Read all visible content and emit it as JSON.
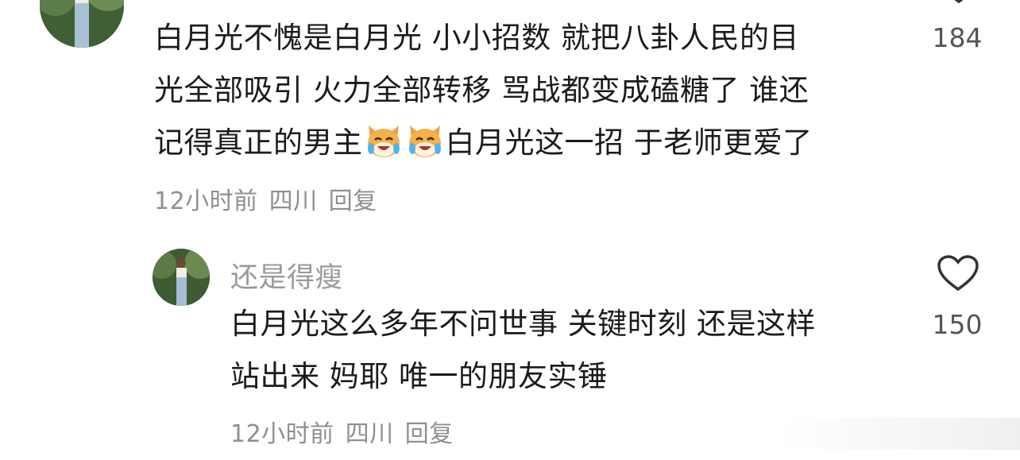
{
  "comments": [
    {
      "lines": [
        "白月光不愧是白月光 小小招数 就把八卦人民的目",
        "光全部吸引 火力全部转移 骂战都变成磕糖了 谁还"
      ],
      "line3_before": "记得真正的男主",
      "line3_after": "白月光这一招 于老师更爱了",
      "emoji": "crying-laughing-cat-emoji",
      "time": "12小时前",
      "location": "四川",
      "reply_label": "回复",
      "likes": "184"
    }
  ],
  "reply": {
    "username": "还是得瘦",
    "lines": [
      "白月光这么多年不问世事 关键时刻 还是这样",
      "站出来 妈耶 唯一的朋友实锤"
    ],
    "time": "12小时前",
    "location": "四川",
    "reply_label": "回复",
    "likes": "150"
  },
  "colors": {
    "text": "#1b1b1b",
    "meta": "#8f8f8f",
    "username": "#9a9a9a",
    "heart_outline": "#333333"
  }
}
